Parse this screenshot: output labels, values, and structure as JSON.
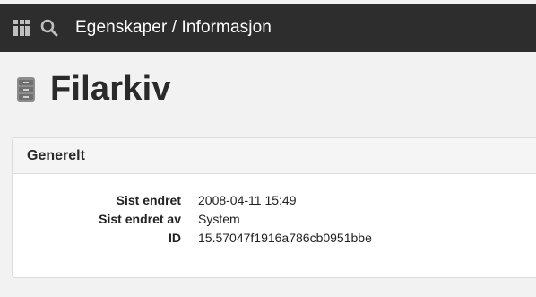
{
  "topbar": {
    "icons": [
      "apps-grid-icon",
      "search-icon"
    ],
    "title": "Egenskaper / Informasjon",
    "background": "#2d2d2d"
  },
  "page": {
    "icon": "file-archive-icon",
    "title": "Filarkiv"
  },
  "panel": {
    "heading": "Generelt",
    "properties": [
      {
        "label": "Sist endret",
        "value": "2008-04-11 15:49"
      },
      {
        "label": "Sist endret av",
        "value": "System"
      },
      {
        "label": "ID",
        "value": "15.57047f1916a786cb0951bbe"
      }
    ]
  }
}
